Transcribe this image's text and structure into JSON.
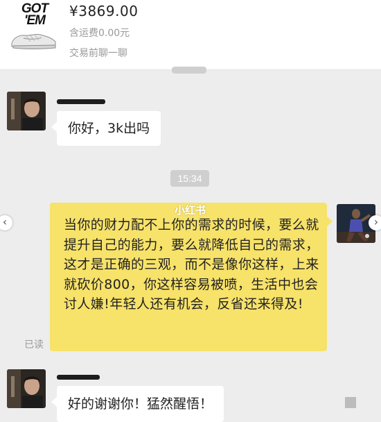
{
  "listing": {
    "brand_logo_text": "GOT 'EM",
    "price": "¥3869.00",
    "shipping": "含运费0.00元",
    "chat_link": "交易前聊一聊"
  },
  "chat": {
    "messages": [
      {
        "text": "你好，3k出吗"
      },
      {
        "time": "15:34"
      },
      {
        "text": "当你的财力配不上你的需求的时候，要么就提升自己的能力，要么就降低自己的需求，这才是正确的三观，而不是像你这样，上来就砍价800，你这样容易被喷，生活中也会讨人嫌!年轻人还有机会，反省还来得及!",
        "status": "已读"
      },
      {
        "text": "好的谢谢你！猛然醒悟！"
      }
    ]
  },
  "watermark": "小红书",
  "colors": {
    "background": "#ededed",
    "outgoing_bubble": "#f7e26a",
    "incoming_bubble": "#ffffff",
    "time_pill": "#cfcfcf"
  },
  "icons": {
    "left_arrow": "chevron-left-icon",
    "right_arrow": "chevron-right-icon"
  }
}
